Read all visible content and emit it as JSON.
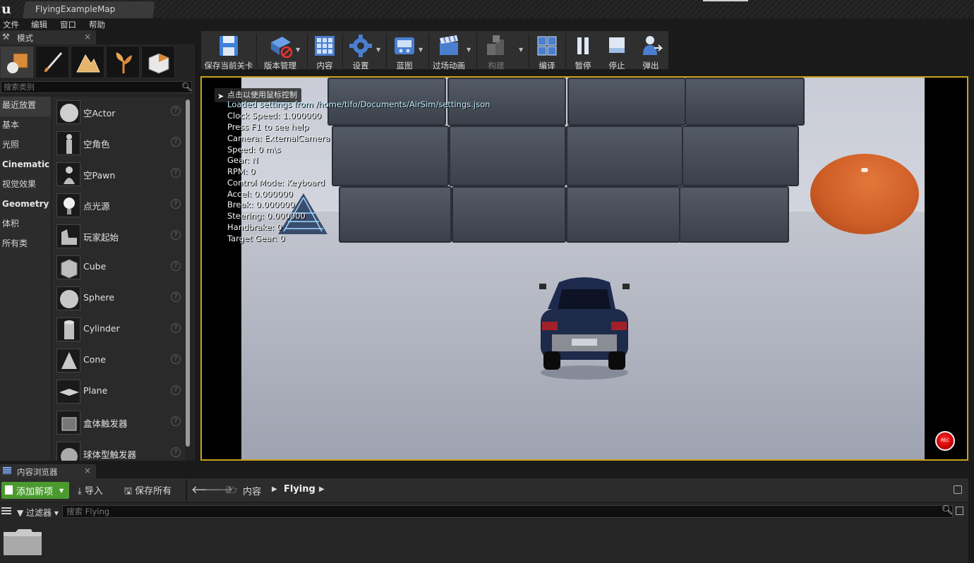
{
  "titlebar": {
    "doc_tab": "FlyingExampleMap"
  },
  "menu": [
    "文件",
    "编辑",
    "窗口",
    "帮助"
  ],
  "modes_panel": {
    "tab_label": "模式",
    "search_placeholder": "搜索类别",
    "categories": [
      "最近放置",
      "基本",
      "光照",
      "Cinematic",
      "视觉效果",
      "Geometry",
      "体积",
      "所有类"
    ],
    "actors": [
      "空Actor",
      "空角色",
      "空Pawn",
      "点光源",
      "玩家起始",
      "Cube",
      "Sphere",
      "Cylinder",
      "Cone",
      "Plane",
      "盒体触发器",
      "球体型触发器"
    ]
  },
  "toolbar": {
    "save": "保存当前关卡",
    "source_control": "版本管理",
    "content": "内容",
    "settings": "设置",
    "blueprints": "蓝图",
    "cinematics": "过场动画",
    "build": "构建",
    "compile": "编译",
    "pause": "暂停",
    "stop": "停止",
    "eject": "弹出"
  },
  "viewport": {
    "click_hint": "点击以使用鼠标控制",
    "hud": [
      "Loaded settings from /home/tifo/Documents/AirSim/settings.json",
      "Clock Speed: 1.000000",
      "Press F1 to see help",
      "Camera: ExternalCamera",
      "Speed: 0 m\\s",
      "Gear: N",
      "RPM: 0",
      "Control Mode: Keyboard",
      "Accel: 0.000000",
      "Break: 0.000000",
      "Steering: 0.000000",
      "Handbrake: 0",
      "Target Gear: 0"
    ],
    "record_label": "REC"
  },
  "content_browser": {
    "tab_label": "内容浏览器",
    "add_new": "添加新项",
    "import": "导入",
    "save_all": "保存所有",
    "breadcrumb": [
      "内容",
      "Flying"
    ],
    "filters": "过滤器",
    "search_placeholder": "搜索 Flying"
  },
  "colors": {
    "viewport_border": "#c8a11b",
    "add_new_green": "#4a9a2e",
    "egg_orange": "#cf5f27",
    "car_blue": "#1e2a4a"
  }
}
